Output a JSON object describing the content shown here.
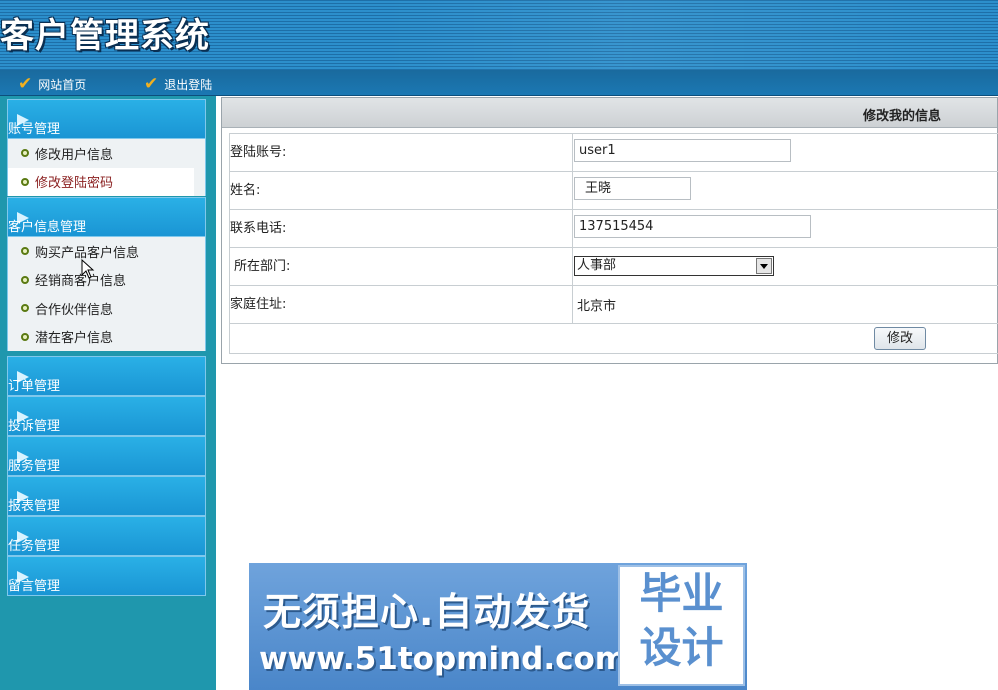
{
  "header": {
    "title": "客户管理系统"
  },
  "topnav": [
    {
      "label": "网站首页"
    },
    {
      "label": "退出登陆"
    }
  ],
  "sidebar": {
    "groups": [
      {
        "label": "账号管理",
        "items": [
          {
            "label": "修改用户信息"
          },
          {
            "label": "修改登陆密码",
            "active": true
          }
        ]
      },
      {
        "label": "客户信息管理",
        "items": [
          {
            "label": "购买产品客户信息"
          },
          {
            "label": "经销商客户信息"
          },
          {
            "label": "合作伙伴信息"
          },
          {
            "label": "潜在客户信息"
          }
        ]
      },
      {
        "label": "订单管理",
        "items": []
      },
      {
        "label": "投诉管理",
        "items": []
      },
      {
        "label": "服务管理",
        "items": []
      },
      {
        "label": "报表管理",
        "items": []
      },
      {
        "label": "任务管理",
        "items": []
      },
      {
        "label": "留言管理",
        "items": []
      }
    ]
  },
  "panel": {
    "title": "修改我的信息",
    "fields": {
      "account": {
        "label": "登陆账号:",
        "value": "user1"
      },
      "name": {
        "label": "姓名:",
        "value": "王晓"
      },
      "phone": {
        "label": "联系电话:",
        "value": "137515454"
      },
      "department": {
        "label": "所在部门:",
        "value": "人事部"
      },
      "address": {
        "label": "家庭住址:",
        "value": "北京市"
      }
    },
    "submit_label": "修改"
  },
  "ad": {
    "line1": "无须担心.自动发货",
    "line2": "www.51topmind.com",
    "badge_line1": "毕业",
    "badge_line2": "设计"
  },
  "icons": {
    "nav_check": "check-icon",
    "group_arrow": "triangle-arrow-icon",
    "item_bullet": "circle-bullet-icon",
    "dropdown": "chevron-down-icon"
  },
  "colors": {
    "header_blue": "#2c8fcc",
    "sidebar_teal": "#1f97ad",
    "group_blue": "#1a95d4",
    "active_item_text": "#8a1f1f"
  }
}
